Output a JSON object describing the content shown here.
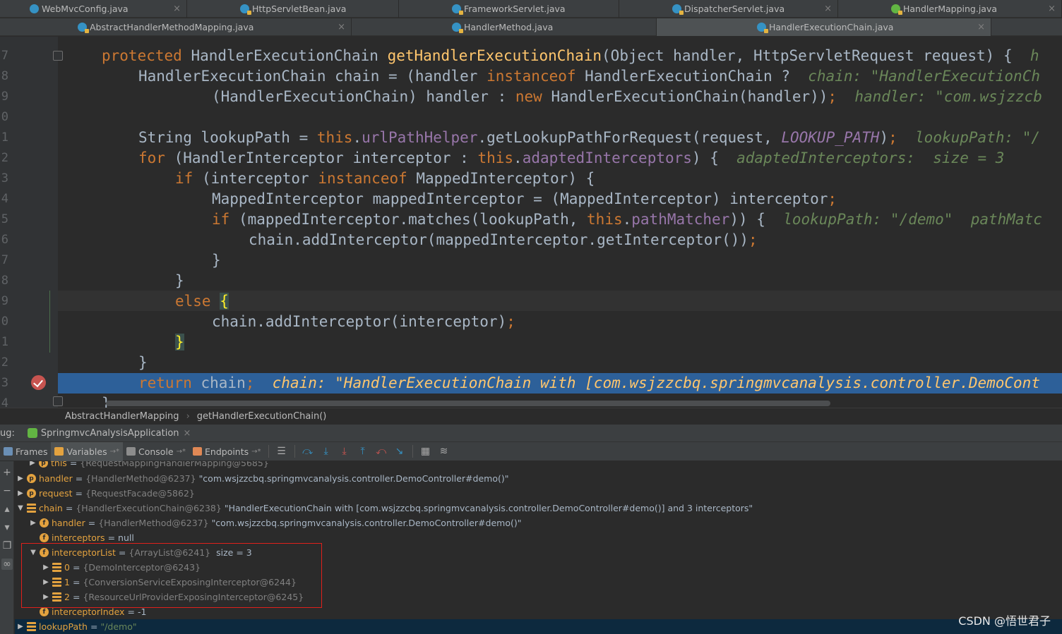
{
  "tabs_row1": [
    {
      "label": "WebMvcConfig.java",
      "close": "×"
    },
    {
      "label": "HttpServletBean.java",
      "close": ""
    },
    {
      "label": "FrameworkServlet.java",
      "close": ""
    },
    {
      "label": "DispatcherServlet.java",
      "close": "×"
    },
    {
      "label": "HandlerMapping.java",
      "close": "×"
    }
  ],
  "tabs_row2": [
    {
      "label": "AbstractHandlerMethodMapping.java",
      "close": "×"
    },
    {
      "label": "HandlerMethod.java",
      "close": ""
    },
    {
      "label": "HandlerExecutionChain.java",
      "close": "×"
    }
  ],
  "line_numbers": [
    "7",
    "8",
    "9",
    "0",
    "1",
    "2",
    "3",
    "4",
    "5",
    "6",
    "7",
    "8",
    "9",
    "0",
    "1",
    "2",
    "3",
    "4"
  ],
  "code": {
    "l1": {
      "kw": "protected",
      "type": " HandlerExecutionChain ",
      "fn": "getHandlerExecutionChain",
      "rest": "(Object handler, HttpServletRequest request) {",
      "hint": "  h"
    },
    "l2": {
      "a": "HandlerExecutionChain chain = (handler ",
      "kw": "instanceof",
      "b": " HandlerExecutionChain ?",
      "hint": "  chain: \"HandlerExecutionCh"
    },
    "l3": {
      "a": "(HandlerExecutionChain) handler : ",
      "kw": "new",
      "b": " HandlerExecutionChain(handler))",
      "semi": ";",
      "hint": "  handler: \"com.wsjzzcb"
    },
    "l4": {
      "a": "String lookupPath = ",
      "kw": "this",
      "dot": ".",
      "fld": "urlPathHelper",
      "b": ".getLookupPathForRequest(request, ",
      "cst": "LOOKUP_PATH",
      "c": ")",
      "semi": ";",
      "hint": "  lookupPath: \"/"
    },
    "l5": {
      "kw": "for",
      "a": " (HandlerInterceptor interceptor : ",
      "kw2": "this",
      "dot": ".",
      "fld": "adaptedInterceptors",
      "b": ") {",
      "hint": "  adaptedInterceptors:  size = 3"
    },
    "l6": {
      "kw": "if",
      "a": " (interceptor ",
      "kw2": "instanceof",
      "b": " MappedInterceptor) {"
    },
    "l7": {
      "a": "MappedInterceptor mappedInterceptor = (MappedInterceptor) interceptor",
      "semi": ";"
    },
    "l8": {
      "kw": "if",
      "a": " (mappedInterceptor.matches(lookupPath, ",
      "kw2": "this",
      "dot": ".",
      "fld": "pathMatcher",
      "b": ")) {",
      "hint": "  lookupPath: \"/demo\"  pathMatc"
    },
    "l9": {
      "a": "chain.addInterceptor(mappedInterceptor.getInterceptor())",
      "semi": ";"
    },
    "l10": {
      "a": "}"
    },
    "l11": {
      "a": "}"
    },
    "l12": {
      "kw": "else",
      "brace": "{"
    },
    "l13": {
      "a": "chain.addInterceptor(interceptor)",
      "semi": ";"
    },
    "l14": {
      "brace": "}"
    },
    "l15": {
      "a": "}"
    },
    "l16": {
      "kw": "return",
      "a": " chain",
      "semi": ";",
      "hint": "  chain: \"HandlerExecutionChain with [com.wsjzzcbq.springmvcanalysis.controller.DemoCont"
    },
    "l17": {
      "a": "}"
    }
  },
  "breadcrumb": {
    "class": "AbstractHandlerMapping",
    "sep": "›",
    "method": "getHandlerExecutionChain()"
  },
  "debug": {
    "prefix": "ug:",
    "session": "SpringmvcAnalysisApplication",
    "session_close": "×",
    "tabs": [
      {
        "label": "Frames",
        "pin": ""
      },
      {
        "label": "Variables",
        "pin": "→*"
      },
      {
        "label": "Console",
        "pin": "→*"
      },
      {
        "label": "Endpoints",
        "pin": "→*"
      }
    ],
    "toolbar_icons": [
      "list-icon",
      "step-over-icon",
      "step-into-icon",
      "force-step-into-icon",
      "step-out-icon",
      "drop-frame-icon",
      "run-to-cursor-icon",
      "evaluate-icon",
      "trace-icon"
    ]
  },
  "variables": [
    {
      "name": "this",
      "type": "{RequestMappingHandlerMapping@5685}",
      "value": "",
      "size": ""
    },
    {
      "name": "handler",
      "type": "{HandlerMethod@6237}",
      "value": "\"com.wsjzzcbq.springmvcanalysis.controller.DemoController#demo()\"",
      "size": ""
    },
    {
      "name": "request",
      "type": "{RequestFacade@5862}",
      "value": "",
      "size": ""
    },
    {
      "name": "chain",
      "type": "{HandlerExecutionChain@6238}",
      "value": "\"HandlerExecutionChain with [com.wsjzzcbq.springmvcanalysis.controller.DemoController#demo()] and 3 interceptors\"",
      "size": ""
    },
    {
      "name": "handler",
      "type": "{HandlerMethod@6237}",
      "value": "\"com.wsjzzcbq.springmvcanalysis.controller.DemoController#demo()\"",
      "size": ""
    },
    {
      "name": "interceptors",
      "type": "",
      "value": "null",
      "size": ""
    },
    {
      "name": "interceptorList",
      "type": "{ArrayList@6241}",
      "value": "",
      "size": "size = 3"
    },
    {
      "name": "0",
      "type": "{DemoInterceptor@6243}",
      "value": "",
      "size": ""
    },
    {
      "name": "1",
      "type": "{ConversionServiceExposingInterceptor@6244}",
      "value": "",
      "size": ""
    },
    {
      "name": "2",
      "type": "{ResourceUrlProviderExposingInterceptor@6245}",
      "value": "",
      "size": ""
    },
    {
      "name": "interceptorIndex",
      "type": "",
      "value": "-1",
      "size": ""
    },
    {
      "name": "lookupPath",
      "type": "",
      "value": "\"/demo\"",
      "size": ""
    }
  ],
  "eq": "=",
  "icon_letters": {
    "param": "p",
    "field": "f"
  },
  "watermark": "CSDN @悟世君子",
  "colors": {
    "keyword": "#cc7832",
    "method": "#ffc66d",
    "field": "#9876aa",
    "hint": "#6a8759",
    "exec_line": "#2d6099",
    "highlight_box": "#e0201b"
  }
}
